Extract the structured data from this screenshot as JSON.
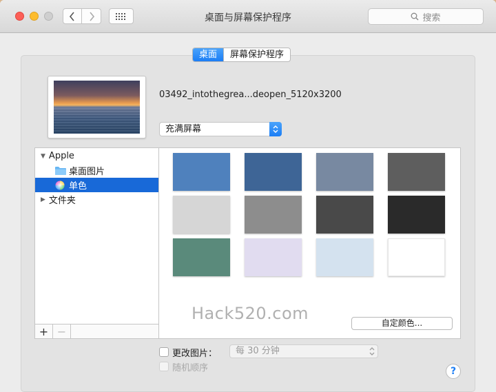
{
  "window": {
    "title": "桌面与屏幕保护程序"
  },
  "toolbar": {
    "back_icon": "chevron-left-icon",
    "forward_icon": "chevron-right-icon",
    "grid_icon": "grid-icon",
    "search_placeholder": "搜索"
  },
  "tabs": [
    {
      "label": "桌面",
      "active": true
    },
    {
      "label": "屏幕保护程序",
      "active": false
    }
  ],
  "preview": {
    "file_name": "03492_intothegrea...deopen_5120x3200",
    "fit_option": "充满屏幕"
  },
  "sources": {
    "items": [
      {
        "label": "Apple",
        "type": "group",
        "expanded": true
      },
      {
        "label": "桌面图片",
        "type": "folder"
      },
      {
        "label": "单色",
        "type": "colors",
        "selected": true
      },
      {
        "label": "文件夹",
        "type": "group",
        "expanded": false
      }
    ],
    "add_label": "+",
    "remove_label": "−"
  },
  "swatches": [
    "#4f81bd",
    "#3e6596",
    "#7889a1",
    "#5e5e5e",
    "#d6d6d6",
    "#8d8d8d",
    "#494949",
    "#2a2a2a",
    "#5a8a7b",
    "#e1dcf0",
    "#d4e2ef",
    "#ffffff"
  ],
  "watermark": "Hack520.com",
  "custom_color_label": "自定颜色...",
  "change_picture": {
    "label": "更改图片：",
    "interval": "每 30 分钟",
    "random_label": "随机顺序"
  },
  "help_label": "?",
  "colors": {
    "accent": "#1c7ef5",
    "selection": "#1869d8"
  }
}
